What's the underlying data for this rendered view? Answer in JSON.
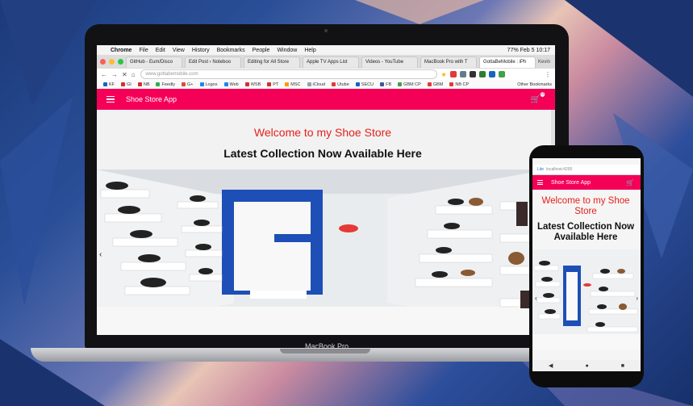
{
  "laptop": {
    "brand_label": "MacBook Pro",
    "mac_menu": [
      "Chrome",
      "File",
      "Edit",
      "View",
      "History",
      "Bookmarks",
      "People",
      "Window",
      "Help"
    ],
    "status_right": "77%  Feb 5  10:17",
    "tabs": [
      {
        "label": "GitHub - Eum/Disco"
      },
      {
        "label": "Edit Post ‹ Noteboo"
      },
      {
        "label": "Editing for All Store"
      },
      {
        "label": "Apple TV Apps List"
      },
      {
        "label": "Videos - YouTube"
      },
      {
        "label": "MacBook Pro with T"
      },
      {
        "label": "GottaBeMobile : iPh"
      }
    ],
    "tab_user": "Kevin",
    "url": "www.gottabemobile.com",
    "bookmarks": [
      {
        "label": "KF",
        "color": "#1565c0"
      },
      {
        "label": "GI",
        "color": "#d32f2f"
      },
      {
        "label": "NB",
        "color": "#d32f2f"
      },
      {
        "label": "Feedly",
        "color": "#2bb24c"
      },
      {
        "label": "G+",
        "color": "#dd4b39"
      },
      {
        "label": "Logos",
        "color": "#1e88e5"
      },
      {
        "label": "Web",
        "color": "#1e88e5"
      },
      {
        "label": "WSB",
        "color": "#d32f2f"
      },
      {
        "label": "PT",
        "color": "#d32f2f"
      },
      {
        "label": "MSC",
        "color": "#ff9800"
      },
      {
        "label": "iCloud",
        "color": "#90a4ae"
      },
      {
        "label": "Utube",
        "color": "#e53935"
      },
      {
        "label": "SECU",
        "color": "#1565c0"
      },
      {
        "label": "FB",
        "color": "#3b5998"
      },
      {
        "label": "GBM CP",
        "color": "#43a047"
      },
      {
        "label": "GBM",
        "color": "#e53935"
      },
      {
        "label": "NB CP",
        "color": "#e53935"
      }
    ],
    "other_bookmarks": "Other Bookmarks"
  },
  "app": {
    "title": "Shoe Store App",
    "cart_count": "0",
    "welcome": "Welcome to my Shoe Store",
    "headline": "Latest Collection Now Available Here",
    "prev_arrow": "‹"
  },
  "phone": {
    "lite_label": "Lite",
    "url": "localhost:4200",
    "title": "Shoe Store App",
    "cart_count": "0",
    "welcome": "Welcome to my Shoe Store",
    "headline": "Latest Collection Now Available Here",
    "nav": [
      "◀",
      "●",
      "■"
    ]
  },
  "colors": {
    "app_primary": "#f50057",
    "welcome_text": "#e4211b"
  }
}
